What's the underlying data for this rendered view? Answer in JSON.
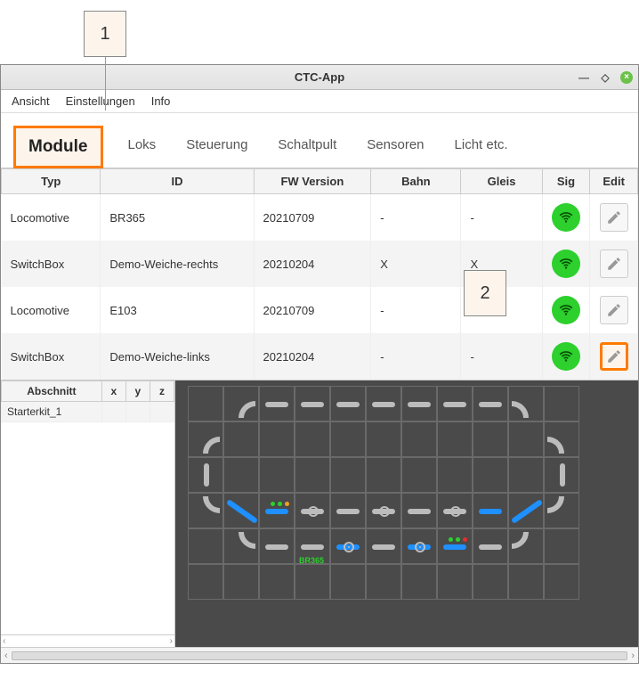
{
  "callouts": {
    "c1": "1",
    "c2": "2"
  },
  "window": {
    "title": "CTC-App"
  },
  "menu": {
    "ansicht": "Ansicht",
    "einstellungen": "Einstellungen",
    "info": "Info"
  },
  "tabs": {
    "module": "Module",
    "loks": "Loks",
    "steuerung": "Steuerung",
    "schaltpult": "Schaltpult",
    "sensoren": "Sensoren",
    "licht": "Licht etc."
  },
  "columns": {
    "typ": "Typ",
    "id": "ID",
    "fw": "FW Version",
    "bahn": "Bahn",
    "gleis": "Gleis",
    "sig": "Sig",
    "edit": "Edit"
  },
  "rows": [
    {
      "typ": "Locomotive",
      "id": "BR365",
      "fw": "20210709",
      "bahn": "-",
      "gleis": "-"
    },
    {
      "typ": "SwitchBox",
      "id": "Demo-Weiche-rechts",
      "fw": "20210204",
      "bahn": "X",
      "gleis": "X"
    },
    {
      "typ": "Locomotive",
      "id": "E103",
      "fw": "20210709",
      "bahn": "-",
      "gleis": "-"
    },
    {
      "typ": "SwitchBox",
      "id": "Demo-Weiche-links",
      "fw": "20210204",
      "bahn": "-",
      "gleis": "-"
    }
  ],
  "sections": {
    "abschnitt_hdr": "Abschnitt",
    "x_hdr": "x",
    "y_hdr": "y",
    "z_hdr": "z",
    "row0": {
      "name": "Starterkit_1",
      "x": "",
      "y": "",
      "z": ""
    }
  },
  "track_label": "BR365"
}
